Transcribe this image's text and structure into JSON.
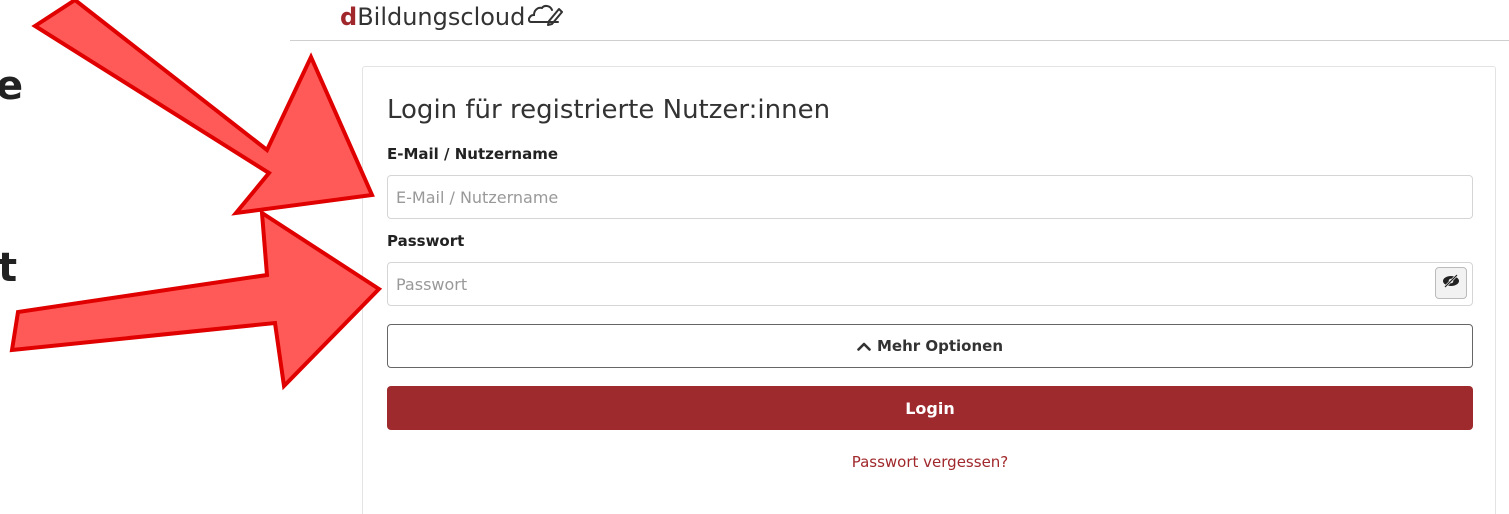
{
  "overlay": {
    "crop_text_top": "e",
    "crop_text_bottom": "t"
  },
  "header": {
    "logo_d": "d",
    "logo_rest": "Bildungscloud"
  },
  "card": {
    "title": "Login für registrierte Nutzer:innen"
  },
  "email": {
    "label": "E-Mail / Nutzername",
    "placeholder": "E-Mail / Nutzername",
    "value": ""
  },
  "password": {
    "label": "Passwort",
    "placeholder": "Passwort",
    "value": ""
  },
  "options_button": {
    "label": "Mehr Optionen"
  },
  "login_button": {
    "label": "Login"
  },
  "forgot_link": {
    "label": "Passwort vergessen?"
  },
  "colors": {
    "brand": "#9e2a2d",
    "arrow_fill": "#ff5a58",
    "arrow_stroke": "#e00000"
  },
  "icons": {
    "logo": "cloud-pencil-icon",
    "password_toggle": "eye-slash-icon",
    "options": "chevron-up-icon"
  }
}
